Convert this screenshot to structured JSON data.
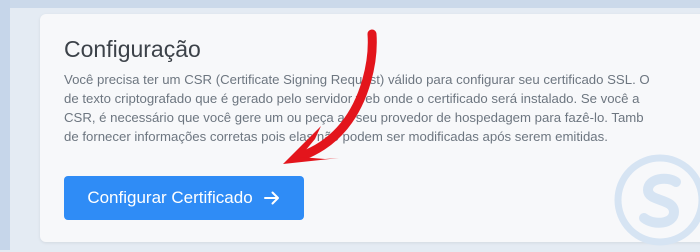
{
  "section": {
    "title": "Configuração",
    "description_lines": [
      "Você precisa ter um CSR (Certificate Signing Request) válido para configurar seu certificado SSL. O",
      "de texto criptografado que é gerado pelo servidor web onde o certificado será instalado. Se você a",
      "CSR, é necessário que você gere um ou peça ao seu provedor de hospedagem para fazê-lo. Tamb",
      "de fornecer informações corretas pois elas não podem ser modificadas após serem emitidas."
    ]
  },
  "action": {
    "button_label": "Configurar Certificado",
    "icon": "arrow-right-icon"
  },
  "annotation": {
    "icon": "red-pointer-arrow-icon",
    "color": "#e3151c"
  },
  "watermark": {
    "icon": "s-logo-icon",
    "color": "#d6e4f3"
  },
  "colors": {
    "button": "#2f8cf6",
    "title": "#3c4249",
    "text": "#6d7680",
    "card": "#f7f8fa",
    "background": "#e4ebf3"
  }
}
